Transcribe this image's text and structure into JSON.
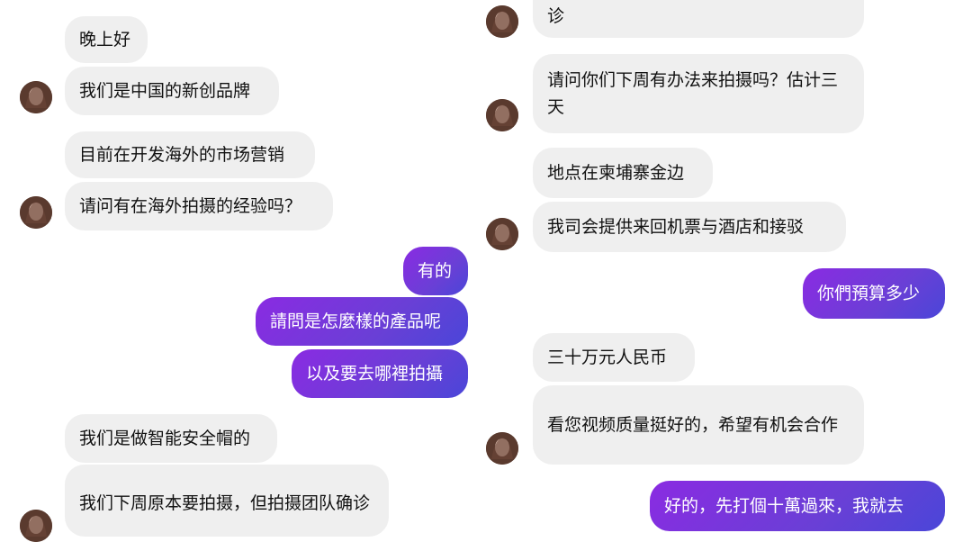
{
  "left": {
    "messages": [
      {
        "text": "晚上好"
      },
      {
        "text": "我们是中国的新创品牌"
      },
      {
        "text": "目前在开发海外的市场营销"
      },
      {
        "text": "请问有在海外拍摄的经验吗？"
      },
      {
        "text": "有的"
      },
      {
        "text": "請問是怎麼樣的產品呢"
      },
      {
        "text": "以及要去哪裡拍攝"
      },
      {
        "text": "我们是做智能安全帽的"
      },
      {
        "text": "我们下周原本要拍摄，但拍摄团队确诊"
      }
    ]
  },
  "right": {
    "messages": [
      {
        "text": "诊"
      },
      {
        "text": "请问你们下周有办法来拍摄吗？估计三天"
      },
      {
        "text": "地点在柬埔寨金边"
      },
      {
        "text": "我司会提供来回机票与酒店和接驳"
      },
      {
        "text": "你們預算多少"
      },
      {
        "text": "三十万元人民币"
      },
      {
        "text": "看您视频质量挺好的，希望有机会合作"
      },
      {
        "text": "好的，先打個十萬過來，我就去"
      }
    ]
  },
  "colors": {
    "incoming_bubble": "#efefef",
    "outgoing_gradient_start": "#8a2be2",
    "outgoing_gradient_end": "#4a46d8"
  },
  "icons": [
    "avatar-icon"
  ]
}
